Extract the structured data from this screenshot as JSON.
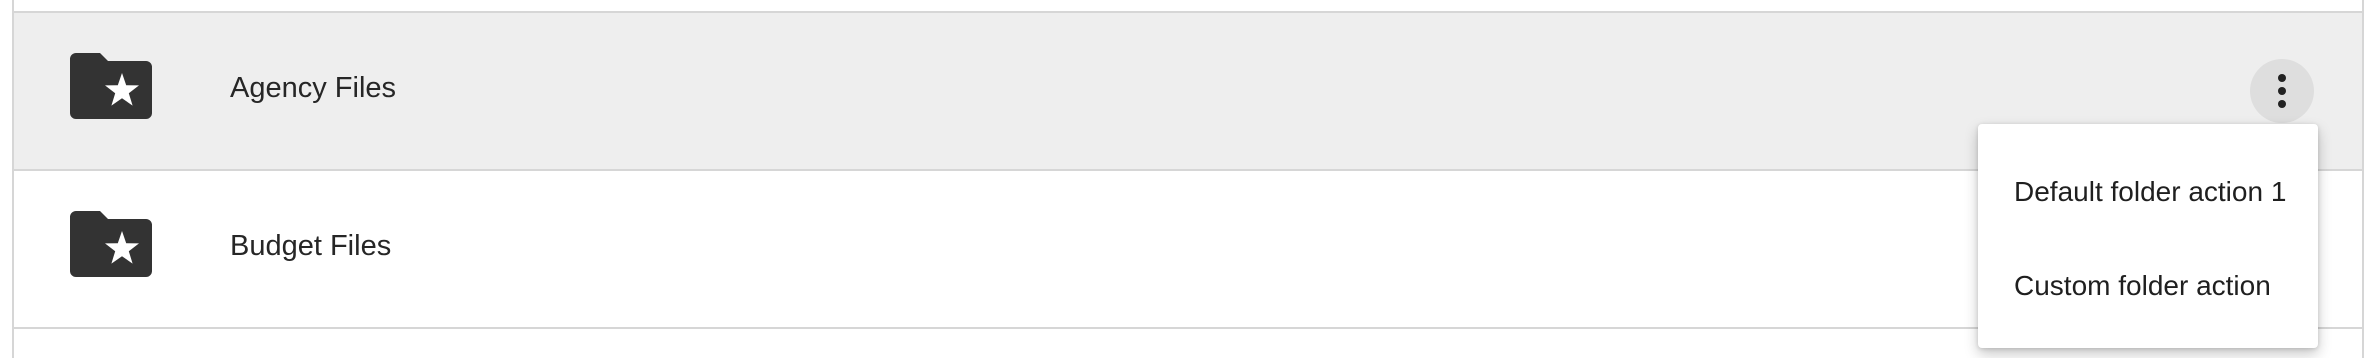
{
  "folders": [
    {
      "name": "Agency Files",
      "icon": "starred-folder-icon",
      "highlighted": true
    },
    {
      "name": "Budget Files",
      "icon": "starred-folder-icon",
      "highlighted": false
    }
  ],
  "actions_button": {
    "icon": "more-vertical-icon"
  },
  "context_menu": {
    "items": [
      {
        "label": "Default folder action 1"
      },
      {
        "label": "Custom folder action"
      }
    ]
  },
  "colors": {
    "row_highlight": "#eeeeee",
    "folder_icon": "#333333",
    "border": "#d6d6d6",
    "text": "#262626"
  }
}
